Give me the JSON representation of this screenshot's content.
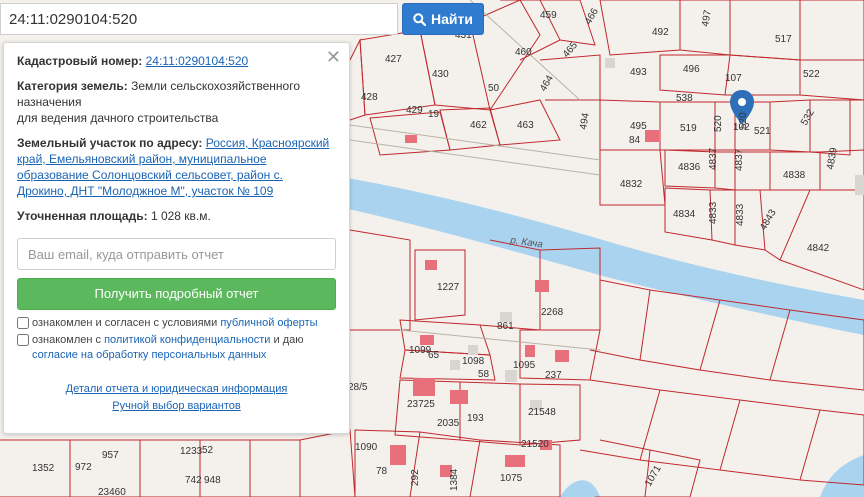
{
  "search": {
    "value": "24:11:0290104:520",
    "button_label": "Найти"
  },
  "map": {
    "river_label": "р. Кача",
    "lot_labels": [
      "459",
      "466",
      "492",
      "497",
      "517",
      "462",
      "431",
      "460",
      "465",
      "493",
      "496",
      "522",
      "427",
      "430",
      "50",
      "464",
      "107",
      "428",
      "429",
      "19",
      "538",
      "463",
      "494",
      "495",
      "519",
      "520",
      "102",
      "520",
      "521",
      "532",
      "84",
      "4836",
      "4837",
      "4837",
      "4838",
      "4839",
      "4832",
      "4834",
      "4833",
      "4833",
      "4843",
      "4842",
      "1227",
      "2268",
      "861",
      "1099",
      "65",
      "1098",
      "58",
      "1095",
      "237",
      "28/5",
      "23725",
      "193",
      "2035",
      "21548",
      "21520",
      "1090",
      "1233",
      "52",
      "957",
      "1352",
      "972",
      "742",
      "948",
      "78",
      "292",
      "1384",
      "1075",
      "23460",
      "1071"
    ]
  },
  "panel": {
    "cadastral_label": "Кадастровый номер:",
    "cadastral_value": "24:11:0290104:520",
    "category_label": "Категория земель:",
    "category_value": "Земли сельскохозяйственного назначения",
    "category_value2": "для ведения дачного строительства",
    "address_label": "Земельный участок по адресу:",
    "address_value": "Россия, Красноярский край, Емельяновский район, муниципальное образование Солонцовский сельсовет, район с. Дрокино, ДНТ \"Молоджное М\", участок № 109",
    "area_label": "Уточненная площадь:",
    "area_value": "1 028 кв.м.",
    "email_placeholder": "Ваш email, куда отправить отчет",
    "get_report_label": "Получить подробный отчет",
    "check1_text": "ознакомлен и согласен с условиями",
    "check1_link": "публичной оферты",
    "check2_text": "ознакомлен с",
    "check2_link": "политикой конфиденциальности",
    "check2_text2": "и даю",
    "check2_link2": "согласие на обработку персональных данных",
    "link_details": "Детали отчета и юридическая информация",
    "link_manual": "Ручной выбор вариантов"
  },
  "colors": {
    "parcel_border": "#c0282d",
    "river": "#a9d3ee",
    "building": "#e7707a",
    "accent_blue": "#2f7bd0",
    "green": "#5cb85c",
    "marker": "#2f6fb8"
  }
}
